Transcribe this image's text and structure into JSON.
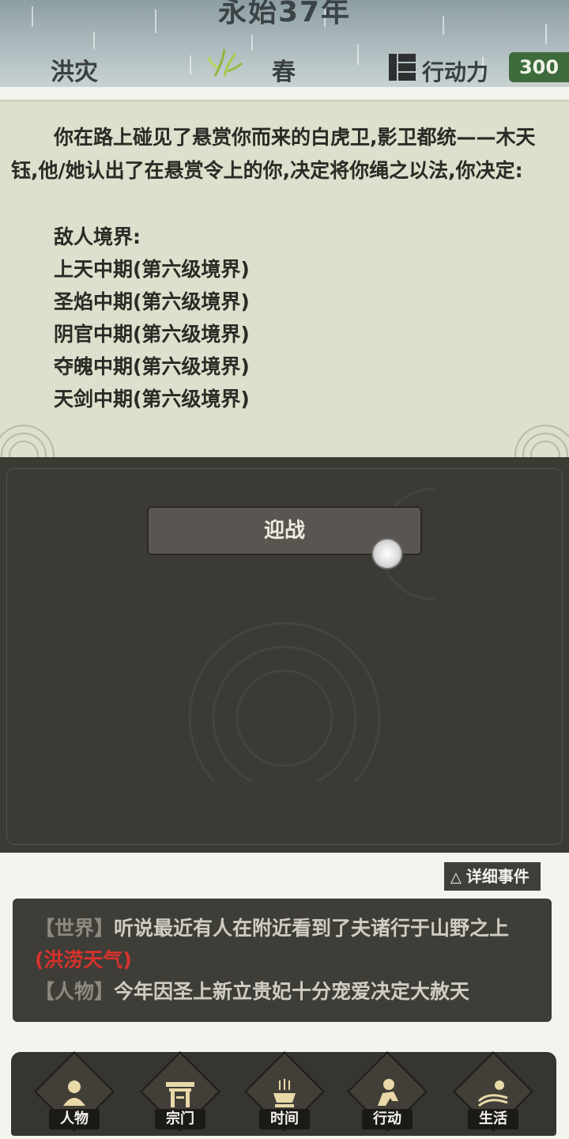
{
  "header": {
    "year": "永始37年",
    "disaster": "洪灾",
    "season": "春",
    "action_label": "行动力",
    "action_value": "300"
  },
  "story": {
    "text": "你在路上碰见了悬赏你而来的白虎卫,影卫都统——木天钰,他/她认出了在悬赏令上的你,决定将你绳之以法,你决定:",
    "enemy_title": "敌人境界:",
    "enemies": [
      "上天中期(第六级境界)",
      "圣焰中期(第六级境界)",
      "阴官中期(第六级境界)",
      "夺魄中期(第六级境界)",
      "天剑中期(第六级境界)"
    ]
  },
  "choice": {
    "button_label": "迎战"
  },
  "detail_button": {
    "icon": "triangle-up-icon",
    "label": "详细事件"
  },
  "log": {
    "line1_tag": "【世界】",
    "line1_text": "听说最近有人在附近看到了夫诸行于山野之上",
    "line1_highlight": "(洪涝天气)",
    "line2_tag": "【人物】",
    "line2_text": "今年因圣上新立贵妃十分宠爱决定大赦天"
  },
  "nav": {
    "items": [
      {
        "label": "人物",
        "icon": "person-icon"
      },
      {
        "label": "宗门",
        "icon": "gate-icon"
      },
      {
        "label": "时间",
        "icon": "incense-icon"
      },
      {
        "label": "行动",
        "icon": "action-person-icon"
      },
      {
        "label": "生活",
        "icon": "landscape-icon"
      }
    ]
  },
  "colors": {
    "accent_green": "#3d6b3c",
    "log_red": "#d6322b",
    "panel_dark": "#3b3a35",
    "story_bg": "#dedfcc"
  }
}
